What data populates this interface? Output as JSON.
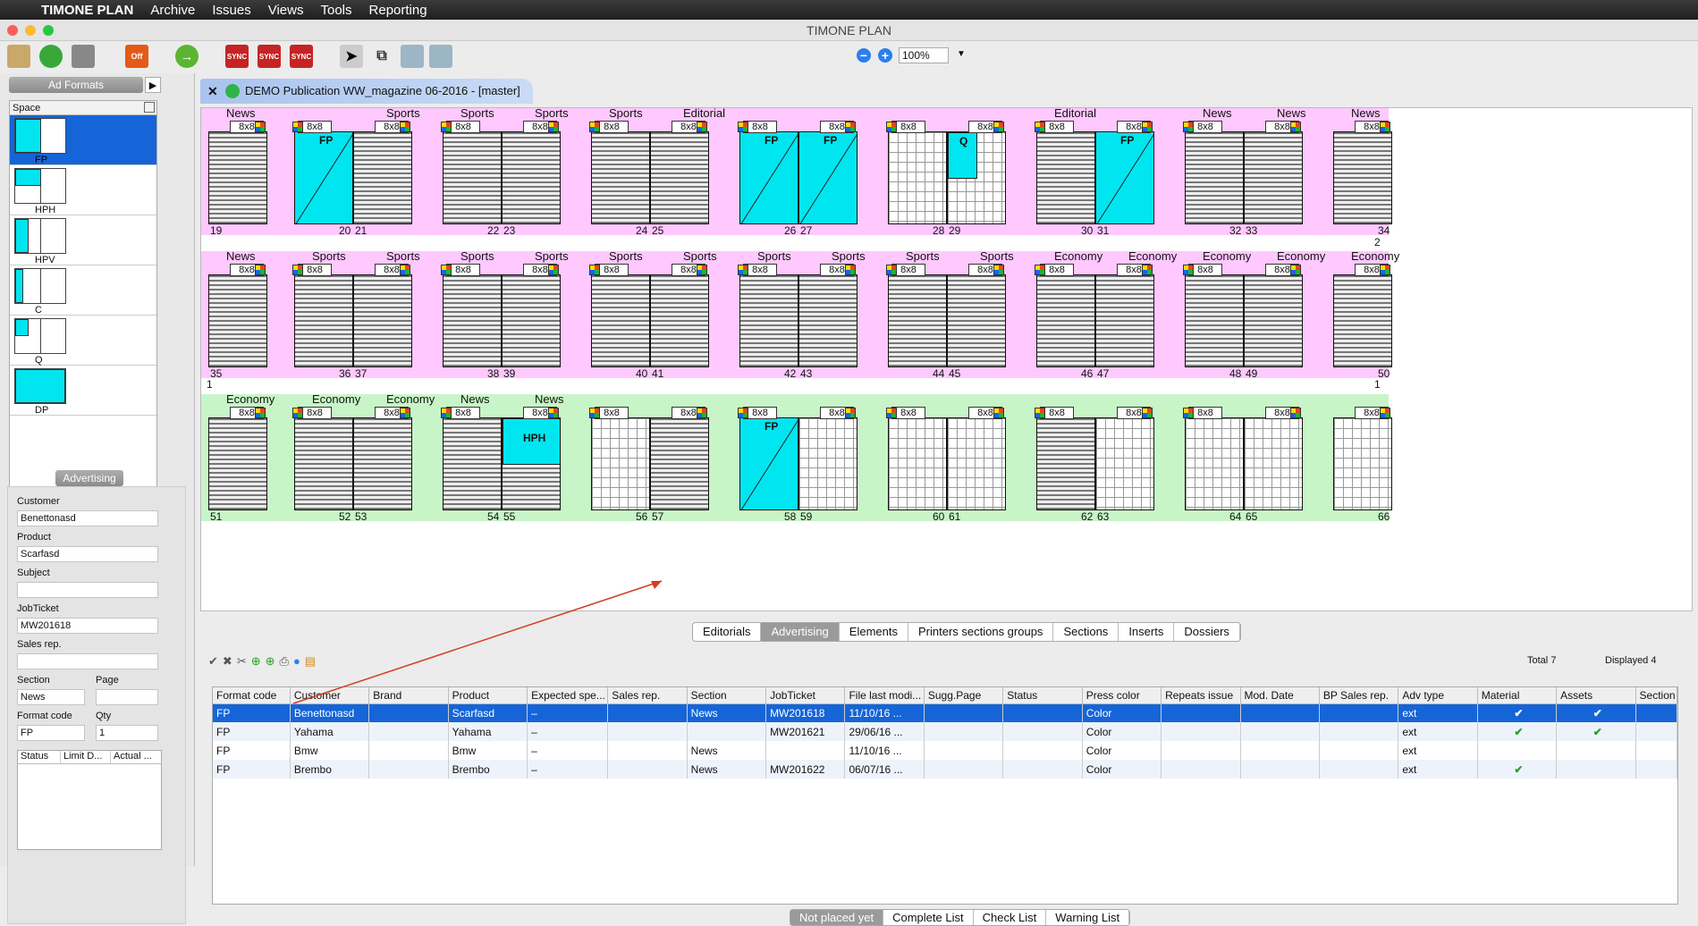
{
  "menubar": {
    "app": "TIMONE PLAN",
    "items": [
      "Archive",
      "Issues",
      "Views",
      "Tools",
      "Reporting"
    ]
  },
  "window_title": "TIMONE PLAN",
  "zoom": "100%",
  "off_badge": "Off",
  "sync_label": "SYNC",
  "left": {
    "ad_formats_title": "Ad Formats",
    "space_header": "Space",
    "formats": [
      "FP",
      "HPH",
      "HPV",
      "C",
      "Q",
      "DP"
    ],
    "advertising_title": "Advertising",
    "labels": {
      "customer": "Customer",
      "product": "Product",
      "subject": "Subject",
      "jobticket": "JobTicket",
      "sales_rep": "Sales rep.",
      "section": "Section",
      "page": "Page",
      "format_code": "Format code",
      "qty": "Qty"
    },
    "values": {
      "customer": "Benettonasd",
      "product": "Scarfasd",
      "subject": "",
      "jobticket": "MW201618",
      "sales_rep": "",
      "section": "News",
      "page": "",
      "format_code": "FP",
      "qty": "1"
    },
    "status_cols": [
      "Status",
      "Limit D...",
      "Actual ..."
    ]
  },
  "doc_tab": "DEMO Publication WW_magazine 06-2016 - [master]",
  "rows": [
    {
      "bg": "#ffc8ff",
      "spreads": [
        {
          "sections": [
            "News",
            ""
          ],
          "left": {
            "t": "img",
            "n": "19"
          },
          "right": null
        },
        {
          "sections": [
            "",
            "Sports"
          ],
          "left": {
            "t": "fp",
            "n": "20"
          },
          "right": {
            "t": "img",
            "n": "21"
          }
        },
        {
          "sections": [
            "Sports",
            "Sports"
          ],
          "left": {
            "t": "img",
            "n": "22"
          },
          "right": {
            "t": "img",
            "n": "23"
          }
        },
        {
          "sections": [
            "Sports",
            "Editorial"
          ],
          "left": {
            "t": "img",
            "n": "24"
          },
          "right": {
            "t": "img",
            "n": "25"
          }
        },
        {
          "sections": [
            "",
            ""
          ],
          "left": {
            "t": "fp",
            "n": "26"
          },
          "right": {
            "t": "fp",
            "n": "27"
          }
        },
        {
          "sections": [
            "",
            ""
          ],
          "left": {
            "t": "grid",
            "n": "28"
          },
          "right": {
            "t": "q",
            "n": "29"
          }
        },
        {
          "sections": [
            "Editorial",
            ""
          ],
          "left": {
            "t": "img",
            "n": "30"
          },
          "right": {
            "t": "fp",
            "n": "31"
          }
        },
        {
          "sections": [
            "News",
            "News"
          ],
          "left": {
            "t": "img",
            "n": "32"
          },
          "right": {
            "t": "img",
            "n": "33"
          }
        },
        {
          "sections": [
            "News",
            ""
          ],
          "left": {
            "t": "img",
            "n": "34"
          },
          "right": null
        }
      ]
    },
    {
      "bg": "#ffc8ff",
      "spreads": [
        {
          "sections": [
            "News",
            ""
          ],
          "left": {
            "t": "img",
            "n": "35"
          },
          "right": null
        },
        {
          "sections": [
            "Sports",
            "Sports"
          ],
          "left": {
            "t": "img",
            "n": "36"
          },
          "right": {
            "t": "img",
            "n": "37"
          }
        },
        {
          "sections": [
            "Sports",
            "Sports"
          ],
          "left": {
            "t": "img",
            "n": "38"
          },
          "right": {
            "t": "img",
            "n": "39"
          }
        },
        {
          "sections": [
            "Sports",
            "Sports"
          ],
          "left": {
            "t": "img",
            "n": "40"
          },
          "right": {
            "t": "img",
            "n": "41"
          }
        },
        {
          "sections": [
            "Sports",
            "Sports"
          ],
          "left": {
            "t": "img",
            "n": "42"
          },
          "right": {
            "t": "img",
            "n": "43"
          }
        },
        {
          "sections": [
            "Sports",
            "Sports"
          ],
          "left": {
            "t": "img",
            "n": "44"
          },
          "right": {
            "t": "img",
            "n": "45"
          }
        },
        {
          "sections": [
            "Economy",
            "Economy"
          ],
          "left": {
            "t": "img",
            "n": "46"
          },
          "right": {
            "t": "img",
            "n": "47"
          }
        },
        {
          "sections": [
            "Economy",
            "Economy"
          ],
          "left": {
            "t": "img",
            "n": "48"
          },
          "right": {
            "t": "img",
            "n": "49"
          }
        },
        {
          "sections": [
            "Economy",
            ""
          ],
          "left": {
            "t": "img",
            "n": "50"
          },
          "right": null
        }
      ]
    },
    {
      "bg": "#c8f5c8",
      "spreads": [
        {
          "sections": [
            "Economy",
            ""
          ],
          "left": {
            "t": "img",
            "n": "51"
          },
          "right": null
        },
        {
          "sections": [
            "Economy",
            "Economy"
          ],
          "left": {
            "t": "img",
            "n": "52"
          },
          "right": {
            "t": "img",
            "n": "53"
          }
        },
        {
          "sections": [
            "News",
            "News"
          ],
          "left": {
            "t": "img",
            "n": "54"
          },
          "right": {
            "t": "hph",
            "n": "55"
          }
        },
        {
          "sections": [
            "",
            ""
          ],
          "left": {
            "t": "grid",
            "n": "56"
          },
          "right": {
            "t": "img",
            "n": "57"
          }
        },
        {
          "sections": [
            "",
            ""
          ],
          "left": {
            "t": "fp",
            "n": "58"
          },
          "right": {
            "t": "grid",
            "n": "59"
          }
        },
        {
          "sections": [
            "",
            ""
          ],
          "left": {
            "t": "grid",
            "n": "60"
          },
          "right": {
            "t": "grid",
            "n": "61"
          }
        },
        {
          "sections": [
            "",
            ""
          ],
          "left": {
            "t": "img",
            "n": "62"
          },
          "right": {
            "t": "grid",
            "n": "63"
          }
        },
        {
          "sections": [
            "",
            ""
          ],
          "left": {
            "t": "grid",
            "n": "64"
          },
          "right": {
            "t": "grid",
            "n": "65"
          }
        },
        {
          "sections": [
            "",
            ""
          ],
          "left": {
            "t": "grid",
            "n": "66"
          },
          "right": null
        }
      ]
    }
  ],
  "row_markers": {
    "r2_right": "2",
    "r3_left": "1",
    "r3_right": "1"
  },
  "page_tag": "8x8",
  "fp_label": "FP",
  "q_label": "Q",
  "hph_label": "HPH",
  "panel_tabs": [
    "Editorials",
    "Advertising",
    "Elements",
    "Printers sections groups",
    "Sections",
    "Inserts",
    "Dossiers"
  ],
  "active_panel_tab": "Advertising",
  "totals": {
    "total_label": "Total",
    "total": "7",
    "displayed_label": "Displayed",
    "displayed": "4"
  },
  "table": {
    "columns": [
      "Format code",
      "Customer",
      "Brand",
      "Product",
      "Expected spe...",
      "Sales rep.",
      "Section",
      "JobTicket",
      "File last modi...",
      "Sugg.Page",
      "Status",
      "Press color",
      "Repeats issue",
      "Mod. Date",
      "BP Sales rep.",
      "Adv type",
      "Material",
      "Assets",
      "Section"
    ],
    "rows": [
      [
        "FP",
        "Benettonasd",
        "",
        "Scarfasd",
        "–",
        "",
        "News",
        "MW201618",
        "11/10/16 ...",
        "",
        "",
        "Color",
        "",
        "",
        "",
        "ext",
        "✔",
        "✔",
        ""
      ],
      [
        "FP",
        "Yahama",
        "",
        "Yahama",
        "–",
        "",
        "",
        "MW201621",
        "29/06/16 ...",
        "",
        "",
        "Color",
        "",
        "",
        "",
        "ext",
        "✔",
        "✔",
        ""
      ],
      [
        "FP",
        "Bmw",
        "",
        "Bmw",
        "–",
        "",
        "News",
        "",
        "11/10/16 ...",
        "",
        "",
        "Color",
        "",
        "",
        "",
        "ext",
        "",
        "",
        ""
      ],
      [
        "FP",
        "Brembo",
        "",
        "Brembo",
        "–",
        "",
        "News",
        "MW201622",
        "06/07/16 ...",
        "",
        "",
        "Color",
        "",
        "",
        "",
        "ext",
        "✔",
        "",
        ""
      ]
    ]
  },
  "bottom_tabs": [
    "Not placed yet",
    "Complete List",
    "Check List",
    "Warning List"
  ],
  "active_bottom_tab": "Not placed yet",
  "colors": {
    "accent": "#1565d8",
    "pink": "#ffc8ff",
    "green": "#c8f5c8",
    "cyan": "#00e6f0"
  }
}
